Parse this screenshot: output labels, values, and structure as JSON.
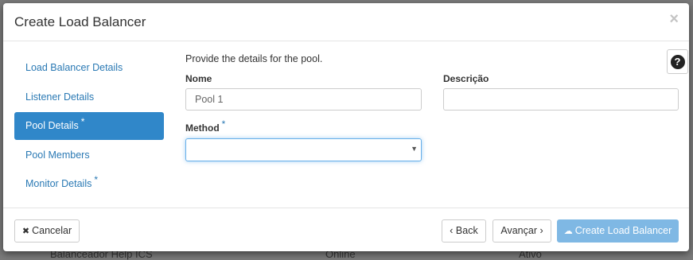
{
  "modal": {
    "title": "Create Load Balancer",
    "close_glyph": "×"
  },
  "nav": {
    "items": [
      {
        "label": "Load Balancer Details",
        "required": false,
        "active": false
      },
      {
        "label": "Listener Details",
        "required": false,
        "active": false
      },
      {
        "label": "Pool Details",
        "required": true,
        "active": true
      },
      {
        "label": "Pool Members",
        "required": false,
        "active": false
      },
      {
        "label": "Monitor Details",
        "required": true,
        "active": false
      }
    ],
    "required_mark": "*"
  },
  "help": {
    "glyph": "?",
    "icon": "question-circle-icon"
  },
  "form": {
    "intro": "Provide the details for the pool.",
    "name_label": "Nome",
    "name_value": "Pool 1",
    "description_label": "Descrição",
    "description_value": "",
    "method_label": "Method",
    "method_required_mark": "*",
    "method_value": "",
    "method_arrow": "▼"
  },
  "footer": {
    "cancel_icon": "✖",
    "cancel_label": "Cancelar",
    "back_label": "‹ Back",
    "next_label": "Avançar ›",
    "create_icon": "☁",
    "create_label": "Create Load Balancer"
  },
  "background_table_row": {
    "cells": [
      "Balanceador Help ICS",
      "Online",
      "Ativo"
    ]
  },
  "colors": {
    "accent": "#3087c9",
    "link": "#2a79b4",
    "primary_disabled": "#7fb8e4",
    "overlay": "#7a7a7a"
  }
}
